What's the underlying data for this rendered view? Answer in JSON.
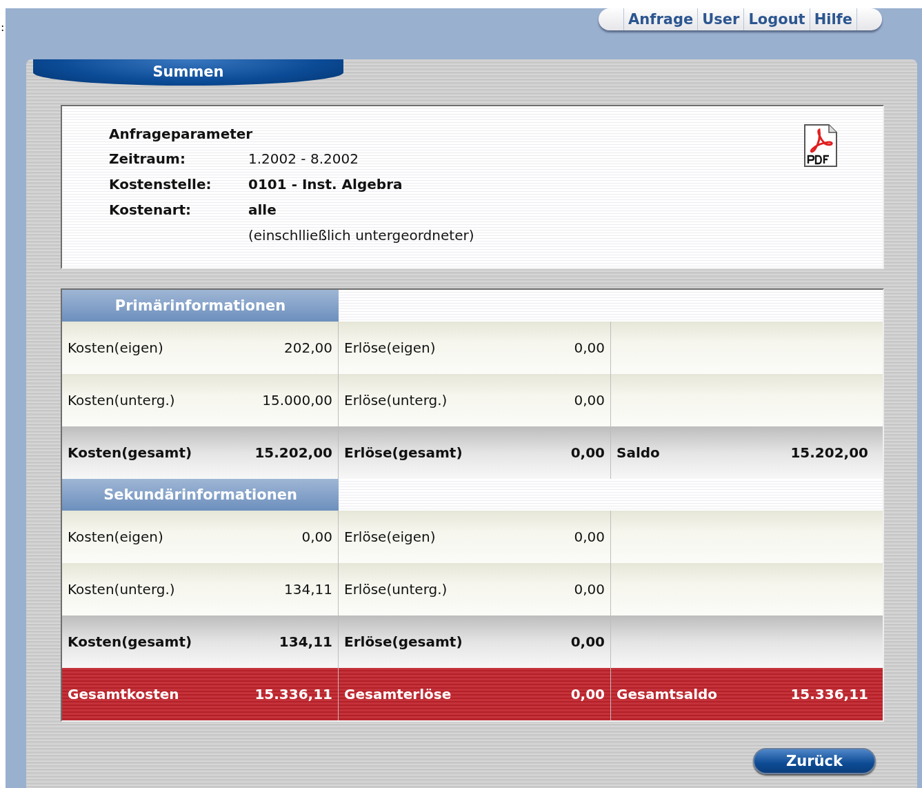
{
  "stray_text": ":",
  "nav": [
    {
      "label": "Anfrage"
    },
    {
      "label": "User"
    },
    {
      "label": "Logout"
    },
    {
      "label": "Hilfe"
    }
  ],
  "panel_title": "Summen",
  "query": {
    "heading": "Anfrageparameter",
    "params": [
      {
        "label": "Zeitraum:",
        "value": "1.2002 - 8.2002",
        "bold": false
      },
      {
        "label": "Kostenstelle:",
        "value": "0101 - Inst. Algebra",
        "bold": true
      },
      {
        "label": "Kostenart:",
        "value": "alle",
        "bold": true
      }
    ],
    "note": "(einschlließlich untergeordneter)"
  },
  "sections": [
    {
      "title": "Primärinformationen",
      "rows": [
        {
          "kind": "normal",
          "cells": [
            {
              "label": "Kosten(eigen)",
              "value": "202,00"
            },
            {
              "label": "Erlöse(eigen)",
              "value": "0,00"
            }
          ]
        },
        {
          "kind": "normal",
          "cells": [
            {
              "label": "Kosten(unterg.)",
              "value": "15.000,00"
            },
            {
              "label": "Erlöse(unterg.)",
              "value": "0,00"
            }
          ]
        },
        {
          "kind": "total",
          "cells": [
            {
              "label": "Kosten(gesamt)",
              "value": "15.202,00"
            },
            {
              "label": "Erlöse(gesamt)",
              "value": "0,00"
            },
            {
              "label": "Saldo",
              "value": "15.202,00"
            }
          ]
        }
      ]
    },
    {
      "title": "Sekundärinformationen",
      "rows": [
        {
          "kind": "normal",
          "cells": [
            {
              "label": "Kosten(eigen)",
              "value": "0,00"
            },
            {
              "label": "Erlöse(eigen)",
              "value": "0,00"
            }
          ]
        },
        {
          "kind": "normal",
          "cells": [
            {
              "label": "Kosten(unterg.)",
              "value": "134,11"
            },
            {
              "label": "Erlöse(unterg.)",
              "value": "0,00"
            }
          ]
        },
        {
          "kind": "total",
          "cells": [
            {
              "label": "Kosten(gesamt)",
              "value": "134,11"
            },
            {
              "label": "Erlöse(gesamt)",
              "value": "0,00"
            }
          ]
        },
        {
          "kind": "grand",
          "cells": [
            {
              "label": "Gesamtkosten",
              "value": "15.336,11"
            },
            {
              "label": "Gesamterlöse",
              "value": "0,00"
            },
            {
              "label": "Gesamtsaldo",
              "value": "15.336,11"
            }
          ]
        }
      ]
    }
  ],
  "back_button": "Zurück"
}
